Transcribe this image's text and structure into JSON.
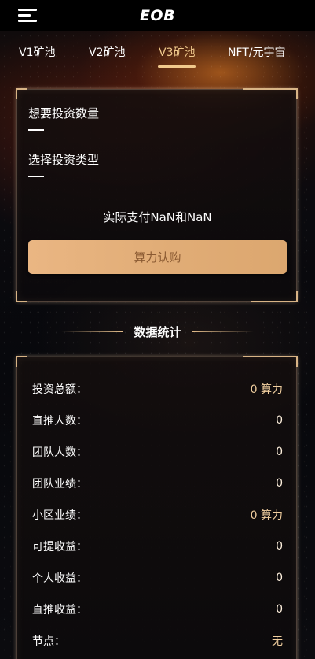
{
  "header": {
    "title": "EOB",
    "menu_icon": "hamburger-menu-icon"
  },
  "tabs": [
    {
      "label": "V1矿池",
      "active": false
    },
    {
      "label": "V2矿池",
      "active": false
    },
    {
      "label": "V3矿池",
      "active": true
    },
    {
      "label": "NFT/元宇宙",
      "active": false
    }
  ],
  "invest": {
    "quantity_label": "想要投资数量",
    "quantity_value": "",
    "type_label": "选择投资类型",
    "type_value": "",
    "pay_text": "实际支付NaN和NaN",
    "buy_button": "算力认购"
  },
  "stats": {
    "title": "数据统计",
    "rows": [
      {
        "label": "投资总额：",
        "value": "0 算力"
      },
      {
        "label": "直推人数：",
        "value": "0"
      },
      {
        "label": "团队人数：",
        "value": "0"
      },
      {
        "label": "团队业绩：",
        "value": "0"
      },
      {
        "label": "小区业绩：",
        "value": "0 算力"
      },
      {
        "label": "可提收益：",
        "value": "0"
      },
      {
        "label": "个人收益：",
        "value": "0"
      },
      {
        "label": "直推收益：",
        "value": "0"
      },
      {
        "label": "节点：",
        "value": "无"
      }
    ]
  },
  "colors": {
    "accent": "#f0c98c",
    "button": "#e1ad77",
    "button_text": "#8a5a32",
    "background": "#06070b"
  }
}
